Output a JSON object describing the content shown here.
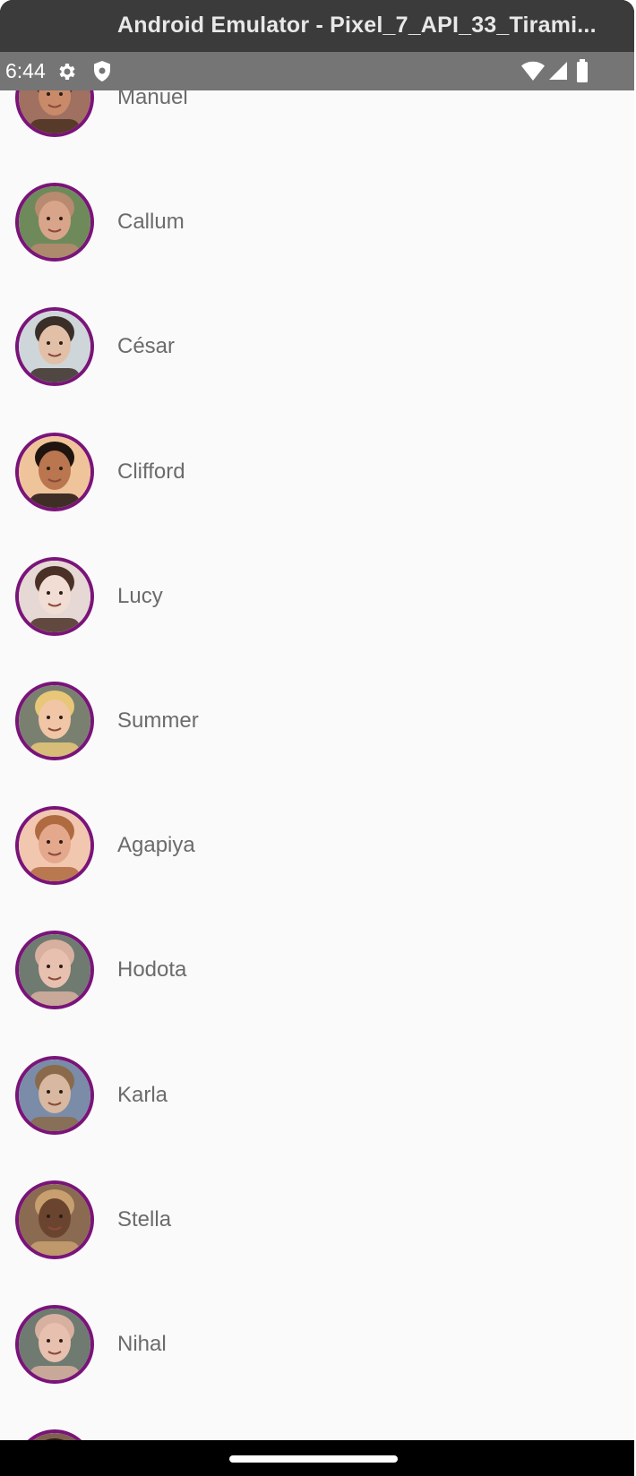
{
  "window": {
    "title": "Android Emulator - Pixel_7_API_33_Tirami..."
  },
  "status_bar": {
    "time": "6:44",
    "icons": [
      "gear-icon",
      "shield-icon",
      "wifi-icon",
      "signal-icon",
      "battery-icon"
    ]
  },
  "contacts": [
    {
      "name": "Manuel",
      "skin": "#c98a6a",
      "hair": "#4a3020",
      "bg": "#a07060"
    },
    {
      "name": "Callum",
      "skin": "#d9a58a",
      "hair": "#b88a70",
      "bg": "#6f8a5a"
    },
    {
      "name": "César",
      "skin": "#e2c0a8",
      "hair": "#3a2e28",
      "bg": "#cfd6da"
    },
    {
      "name": "Clifford",
      "skin": "#b9764f",
      "hair": "#1f1410",
      "bg": "#f0c49a"
    },
    {
      "name": "Lucy",
      "skin": "#f1ddd3",
      "hair": "#4a3026",
      "bg": "#e6d8d4"
    },
    {
      "name": "Summer",
      "skin": "#f0c6a6",
      "hair": "#e8c878",
      "bg": "#7a8070"
    },
    {
      "name": "Agapiya",
      "skin": "#e4a88c",
      "hair": "#b06a40",
      "bg": "#f2c7b0"
    },
    {
      "name": "Hodota",
      "skin": "#e8c0b0",
      "hair": "#d8b0a0",
      "bg": "#6f7a70"
    },
    {
      "name": "Karla",
      "skin": "#d8b8a0",
      "hair": "#8a6a4a",
      "bg": "#7a8ca8"
    },
    {
      "name": "Stella",
      "skin": "#6b4430",
      "hair": "#c8a070",
      "bg": "#8a6a50"
    },
    {
      "name": "Nihal",
      "skin": "#e8c0b0",
      "hair": "#d8b0a0",
      "bg": "#6f7a70"
    },
    {
      "name": "",
      "skin": "#a06a50",
      "hair": "#2a1a10",
      "bg": "#806050"
    }
  ],
  "colors": {
    "avatar_ring": "#7a1479",
    "name_text": "#6b6b6b",
    "background": "#fafafa",
    "status_bar": "#757575",
    "title_bar": "#3b3b3b"
  }
}
